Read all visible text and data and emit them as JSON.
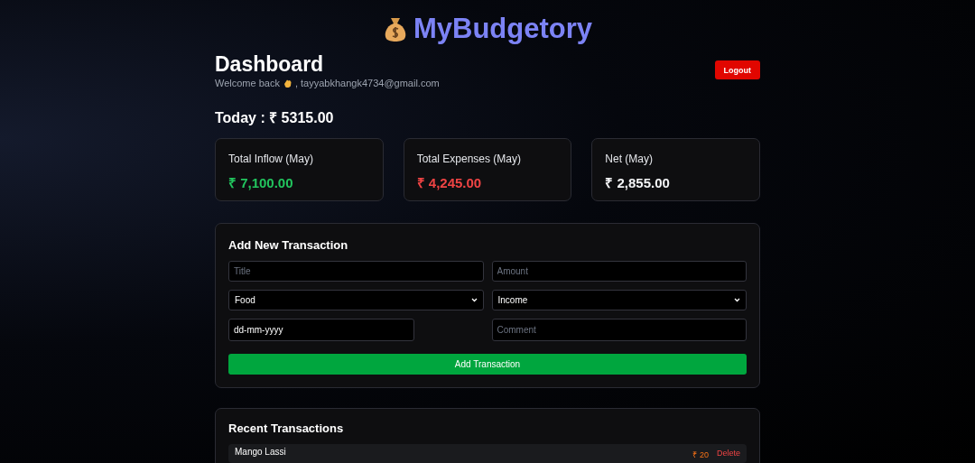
{
  "app": {
    "name": "MyBudgetory"
  },
  "header": {
    "title": "Dashboard",
    "welcome": "Welcome back",
    "email": ", tayyabkhangk4734@gmail.com",
    "logout": "Logout"
  },
  "today": "Today : ₹ 5315.00",
  "summary": [
    {
      "label": "Total Inflow (May)",
      "value": "₹ 7,100.00",
      "kind": "inflow"
    },
    {
      "label": "Total Expenses (May)",
      "value": "₹ 4,245.00",
      "kind": "expense"
    },
    {
      "label": "Net (May)",
      "value": "₹ 2,855.00",
      "kind": "net"
    }
  ],
  "form": {
    "title": "Add New Transaction",
    "title_field": {
      "placeholder": "Title"
    },
    "amount_field": {
      "placeholder": "Amount"
    },
    "category": "Food",
    "type": "Income",
    "date": "dd-mm-yyyy",
    "comment_field": {
      "placeholder": "Comment"
    },
    "submit": "Add Transaction"
  },
  "recent": {
    "title": "Recent Transactions",
    "rows": [
      {
        "title": "Mango Lassi",
        "amount": "₹ 20",
        "action": "Delete"
      }
    ]
  }
}
